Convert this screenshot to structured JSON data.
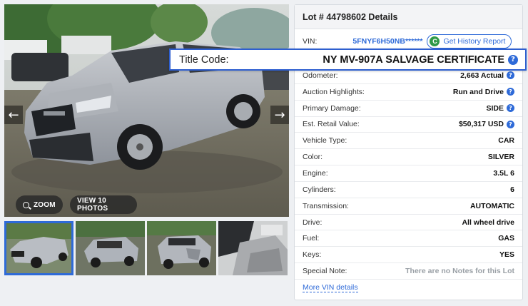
{
  "gallery": {
    "zoom_label": "ZOOM",
    "view_photos_label": "VIEW 10 PHOTOS",
    "prev_icon": "chevron-left-icon",
    "next_icon": "chevron-right-icon",
    "thumbs": [
      "thumb-front-left",
      "thumb-rear-left",
      "thumb-rear-right",
      "thumb-interior"
    ]
  },
  "details": {
    "header": "Lot # 44798602 Details",
    "vin_label": "VIN:",
    "vin_value": "5FNYF6H50NB******",
    "history_button": "Get History Report",
    "history_icon_letter": "C",
    "rows": [
      {
        "label": "Odometer:",
        "value": "2,663 Actual",
        "help": true
      },
      {
        "label": "Auction Highlights:",
        "value": "Run and Drive",
        "help": true
      },
      {
        "label": "Primary Damage:",
        "value": "SIDE",
        "help": true
      },
      {
        "label": "Est. Retail Value:",
        "value": "$50,317 USD",
        "help": true
      },
      {
        "label": "Vehicle Type:",
        "value": "CAR",
        "help": false
      },
      {
        "label": "Color:",
        "value": "SILVER",
        "help": false
      },
      {
        "label": "Engine:",
        "value": "3.5L 6",
        "help": false
      },
      {
        "label": "Cylinders:",
        "value": "6",
        "help": false
      },
      {
        "label": "Transmission:",
        "value": "AUTOMATIC",
        "help": false
      },
      {
        "label": "Drive:",
        "value": "All wheel drive",
        "help": false
      },
      {
        "label": "Fuel:",
        "value": "GAS",
        "help": false
      },
      {
        "label": "Keys:",
        "value": "YES",
        "help": false
      },
      {
        "label": "Special Note:",
        "value": "There are no Notes for this Lot",
        "help": false
      }
    ],
    "more_link": "More VIN details"
  },
  "title_highlight": {
    "label": "Title Code:",
    "value": "NY MV-907A SALVAGE CERTIFICATE"
  },
  "colors": {
    "accent": "#2e6ad8",
    "history_icon": "#2f9a47"
  }
}
